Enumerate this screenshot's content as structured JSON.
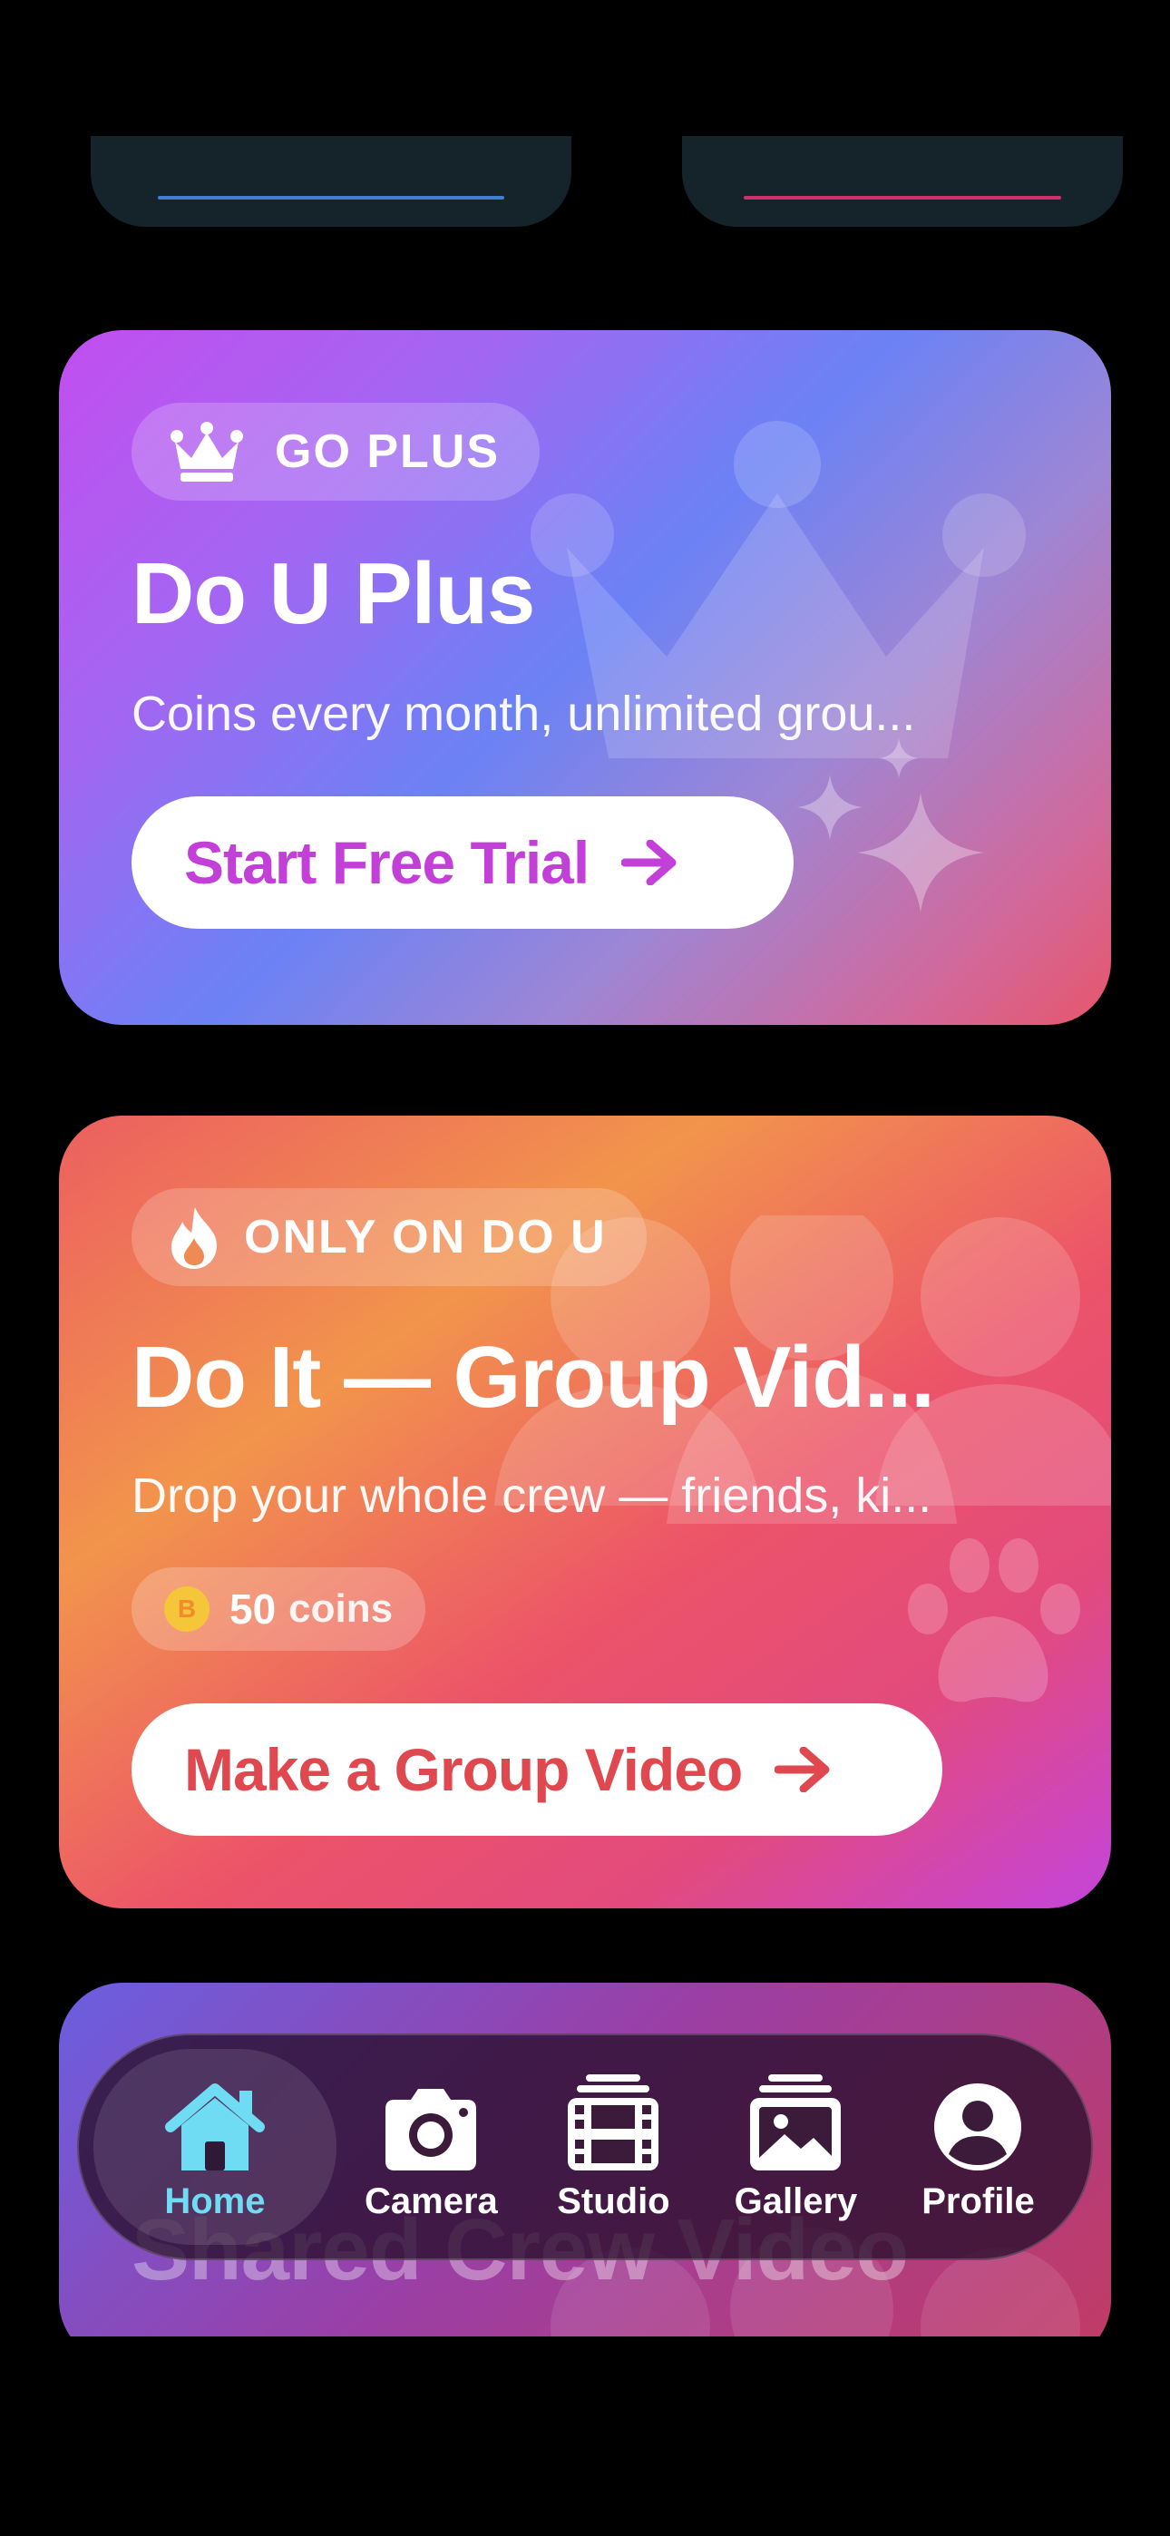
{
  "plus_card": {
    "badge": "GO PLUS",
    "title": "Do U Plus",
    "subtitle": "Coins every month, unlimited grou...",
    "cta": "Start Free Trial",
    "accent": "#c23fd8"
  },
  "group_card": {
    "badge": "ONLY ON DO U",
    "title": "Do It — Group Vid...",
    "subtitle": "Drop your whole crew — friends, ki...",
    "coin_symbol": "B",
    "coin_amount": "50",
    "coin_unit": "coins",
    "cta": "Make a Group Video",
    "accent": "#e0484f"
  },
  "shared_card": {
    "title": "Shared Crew Video"
  },
  "tabbar": {
    "active": "Home",
    "active_color": "#6fdcf3",
    "tabs": [
      {
        "label": "Home",
        "icon": "house-icon"
      },
      {
        "label": "Camera",
        "icon": "camera-icon"
      },
      {
        "label": "Studio",
        "icon": "film-icon"
      },
      {
        "label": "Gallery",
        "icon": "photo-icon"
      },
      {
        "label": "Profile",
        "icon": "person-icon"
      }
    ]
  }
}
